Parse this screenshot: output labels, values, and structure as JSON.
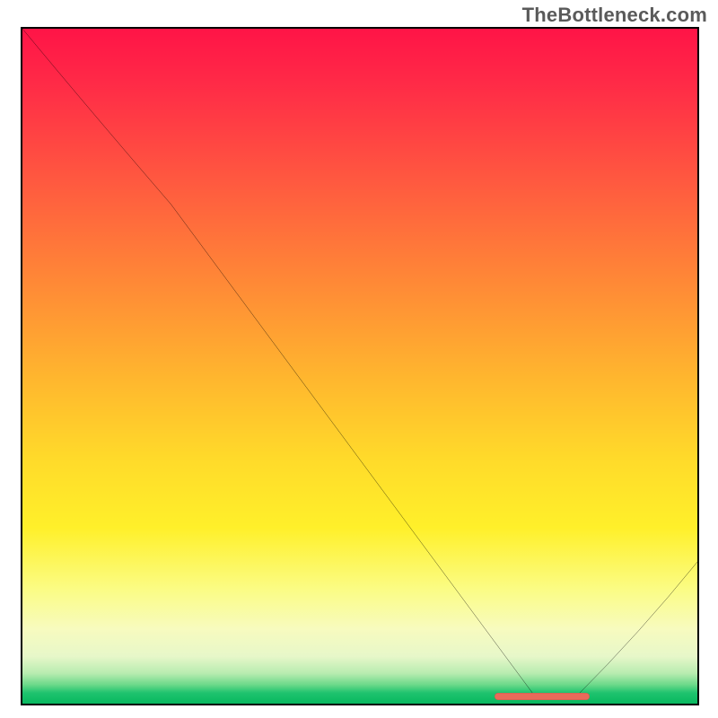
{
  "watermark": "TheBottleneck.com",
  "chart_data": {
    "type": "line",
    "title": "",
    "xlabel": "",
    "ylabel": "",
    "xlim": [
      0,
      100
    ],
    "ylim": [
      0,
      100
    ],
    "grid": false,
    "legend": false,
    "series": [
      {
        "name": "bottleneck-curve",
        "x": [
          0,
          22,
          76,
          82,
          100
        ],
        "y": [
          100,
          74,
          1,
          1,
          21
        ]
      }
    ],
    "highlight_band": {
      "x_start": 70,
      "x_end": 84,
      "y": 1
    },
    "background_gradient": {
      "stops": [
        {
          "pos": 0,
          "color": "#ff1447"
        },
        {
          "pos": 50,
          "color": "#ffb72e"
        },
        {
          "pos": 80,
          "color": "#fff02a"
        },
        {
          "pos": 100,
          "color": "#08b85f"
        }
      ]
    }
  }
}
